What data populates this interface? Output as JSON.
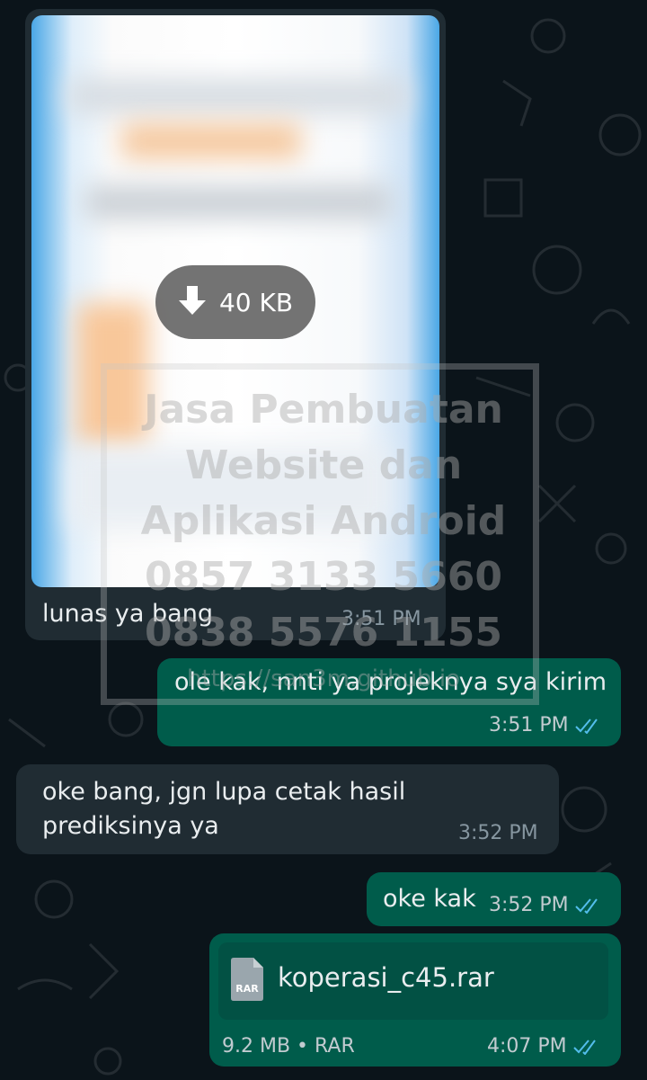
{
  "colors": {
    "background": "#0b141a",
    "incoming_bubble": "#202c33",
    "outgoing_bubble": "#005c4b",
    "read_ticks": "#53bdeb"
  },
  "messages": [
    {
      "kind": "image",
      "direction": "incoming",
      "download": {
        "icon": "download-arrow-icon",
        "size": "40 KB"
      },
      "caption": "lunas ya bang",
      "time": "3:51 PM"
    },
    {
      "kind": "text",
      "direction": "outgoing",
      "text": "ole kak, nnti ya projeknya sya kirim",
      "time": "3:51 PM",
      "status_icon": "double-check-icon"
    },
    {
      "kind": "text",
      "direction": "incoming",
      "text": "oke bang, jgn lupa cetak hasil\nprediksinya ya",
      "time": "3:52 PM"
    },
    {
      "kind": "text",
      "direction": "outgoing",
      "text": "oke kak",
      "time": "3:52 PM",
      "status_icon": "double-check-icon"
    },
    {
      "kind": "document",
      "direction": "outgoing",
      "file_icon": "rar-file-icon",
      "file_icon_label": "RAR",
      "file_name": "koperasi_c45.rar",
      "meta": "9.2 MB • RAR",
      "time": "4:07 PM",
      "status_icon": "double-check-icon"
    }
  ],
  "watermark": {
    "lines": [
      "Jasa Pembuatan",
      "Website dan",
      "Aplikasi Android",
      "0857 3133 5660",
      "0838 5576 1155",
      "https://san3m.github.io"
    ]
  }
}
